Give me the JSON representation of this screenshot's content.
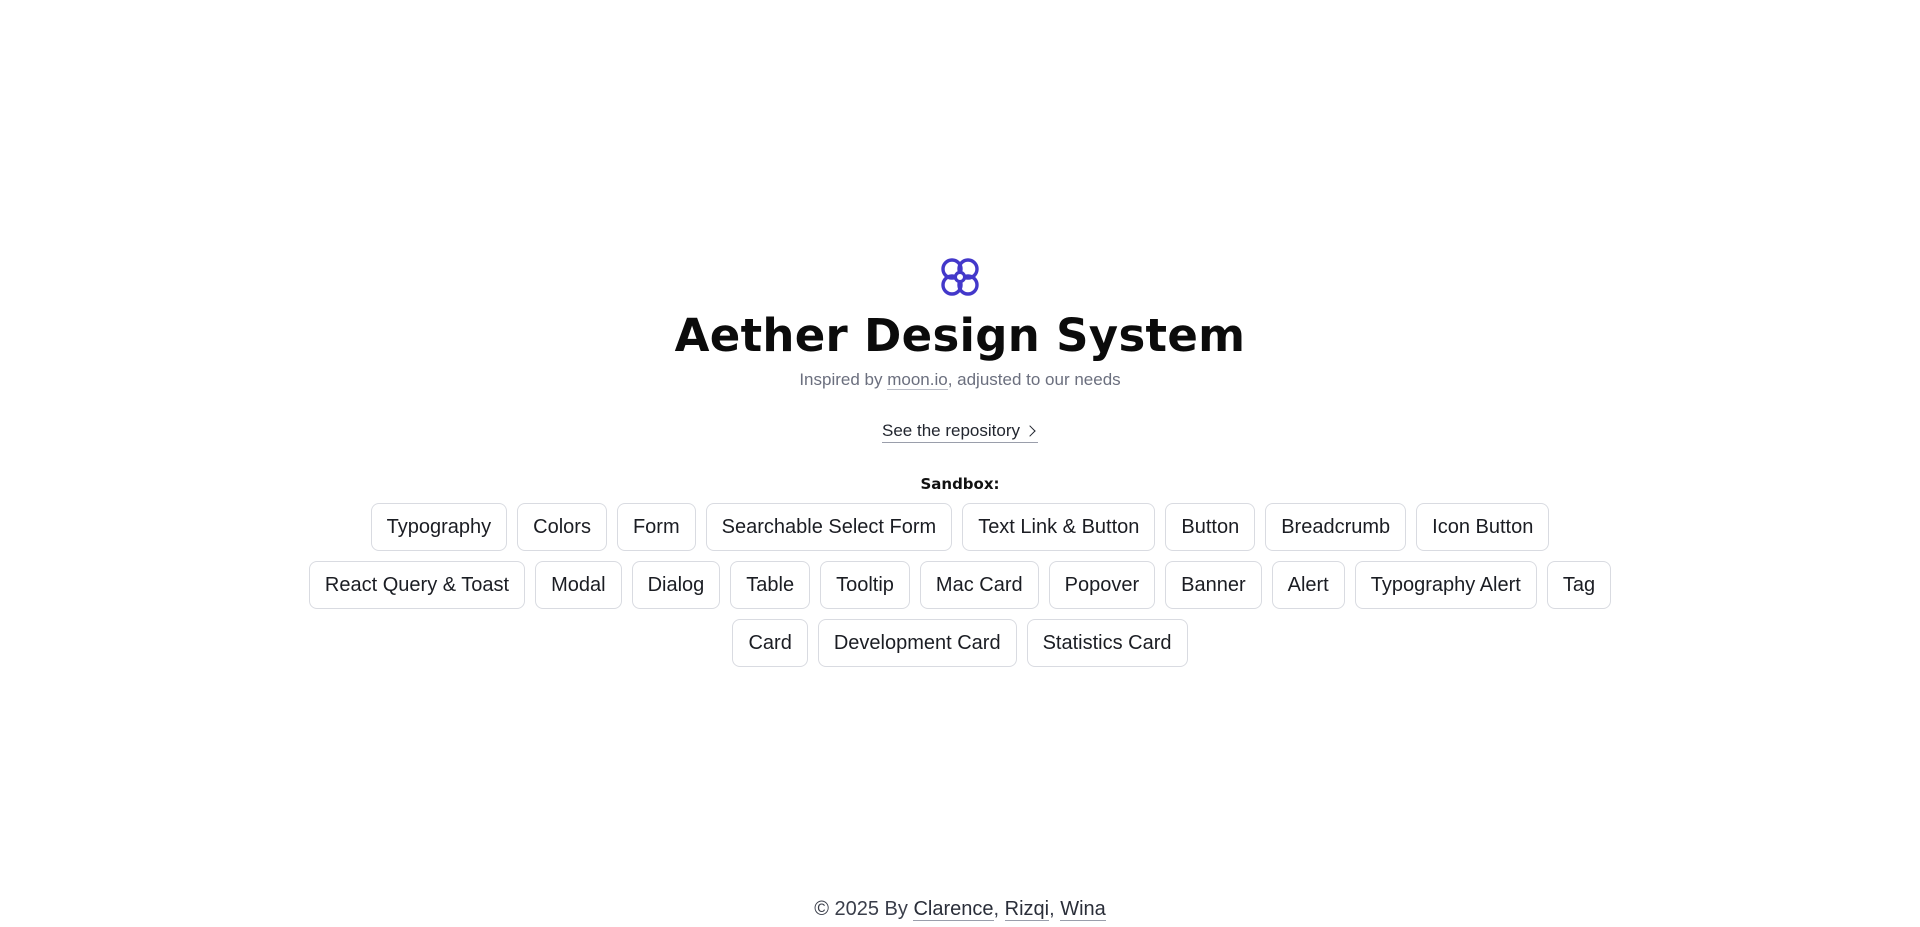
{
  "header": {
    "logo_icon": "flower-knot-icon",
    "accent_color": "#4338ca",
    "title": "Aether Design System",
    "subtitle_prefix": "Inspired by ",
    "subtitle_link": "moon.io",
    "subtitle_suffix": ", adjusted to our needs",
    "repo_link": "See the repository"
  },
  "sandbox": {
    "label": "Sandbox:",
    "rows": [
      [
        "Typography",
        "Colors",
        "Form",
        "Searchable Select Form",
        "Text Link & Button",
        "Button",
        "Breadcrumb",
        "Icon Button"
      ],
      [
        "React Query & Toast",
        "Modal",
        "Dialog",
        "Table",
        "Tooltip",
        "Mac Card",
        "Popover",
        "Banner",
        "Alert",
        "Typography Alert",
        "Tag"
      ],
      [
        "Card",
        "Development Card",
        "Statistics Card"
      ]
    ]
  },
  "footer": {
    "prefix": "© 2025 By ",
    "authors": [
      "Clarence",
      "Rizqi",
      "Wina"
    ],
    "separator": ", "
  }
}
